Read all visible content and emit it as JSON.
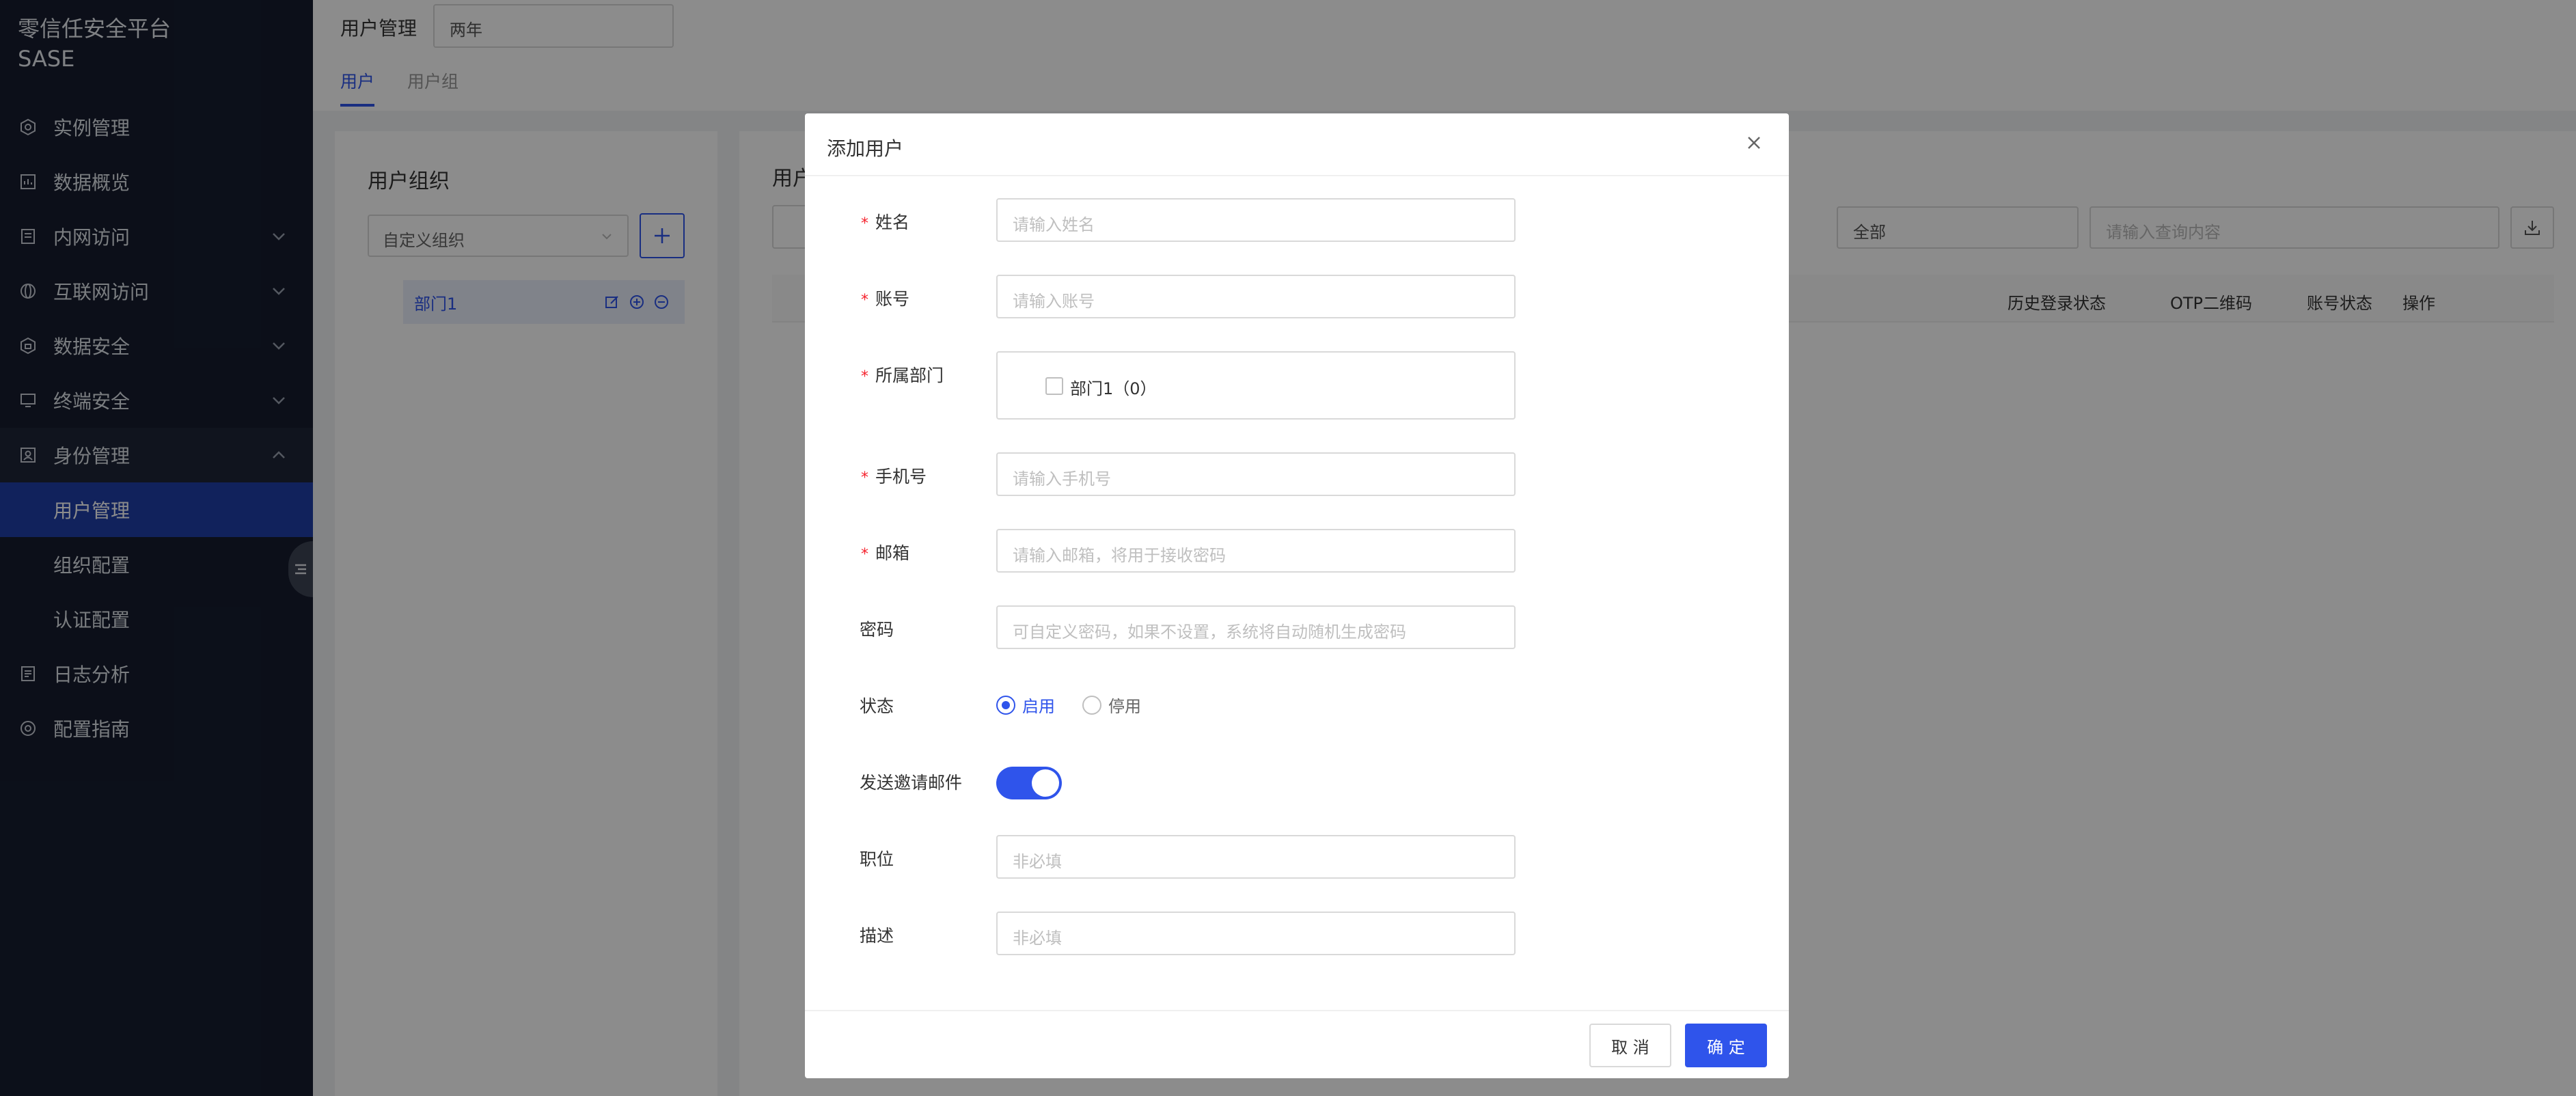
{
  "app": {
    "title_line1": "零信任安全平台",
    "title_line2": "SASE"
  },
  "sidebar": {
    "items": [
      {
        "label": "实例管理",
        "icon": "instance-icon"
      },
      {
        "label": "数据概览",
        "icon": "dashboard-icon"
      },
      {
        "label": "内网访问",
        "icon": "intranet-icon",
        "has_children": true
      },
      {
        "label": "互联网访问",
        "icon": "internet-icon",
        "has_children": true
      },
      {
        "label": "数据安全",
        "icon": "data-security-icon",
        "has_children": true
      },
      {
        "label": "终端安全",
        "icon": "endpoint-icon",
        "has_children": true
      },
      {
        "label": "身份管理",
        "icon": "identity-icon",
        "expanded": true
      },
      {
        "label": "用户管理",
        "sub": true,
        "active": true
      },
      {
        "label": "组织配置",
        "sub": true
      },
      {
        "label": "认证配置",
        "sub": true
      },
      {
        "label": "日志分析",
        "icon": "log-icon"
      },
      {
        "label": "配置指南",
        "icon": "guide-icon"
      }
    ]
  },
  "header": {
    "title": "用户管理",
    "tenant": "两年",
    "tabs": [
      {
        "label": "用户",
        "active": true
      },
      {
        "label": "用户组"
      }
    ]
  },
  "left_panel": {
    "title": "用户组织",
    "org_select": "自定义组织",
    "departments": [
      {
        "label": "部门1"
      }
    ]
  },
  "right_panel": {
    "title": "用户",
    "filter_value": "全部",
    "search_placeholder": "请输入查询内容",
    "columns": [
      "历史登录状态",
      "OTP二维码",
      "账号状态",
      "操作"
    ]
  },
  "modal": {
    "title": "添加用户",
    "fields": {
      "name": {
        "label": "姓名",
        "placeholder": "请输入姓名"
      },
      "account": {
        "label": "账号",
        "placeholder": "请输入账号"
      },
      "department": {
        "label": "所属部门",
        "option": "部门1（0）"
      },
      "phone": {
        "label": "手机号",
        "placeholder": "请输入手机号"
      },
      "email": {
        "label": "邮箱",
        "placeholder": "请输入邮箱，将用于接收密码"
      },
      "password": {
        "label": "密码",
        "placeholder": "可自定义密码，如果不设置，系统将自动随机生成密码"
      },
      "status": {
        "label": "状态",
        "options": [
          "启用",
          "停用"
        ],
        "selected": "启用"
      },
      "invite": {
        "label": "发送邀请邮件",
        "on": true
      },
      "position": {
        "label": "职位",
        "placeholder": "非必填"
      },
      "description": {
        "label": "描述",
        "placeholder": "非必填"
      }
    },
    "cancel": "取 消",
    "ok": "确 定"
  },
  "colors": {
    "accent": "#2f54eb",
    "sidebar_bg": "#161d2f",
    "required": "#f5222d"
  }
}
